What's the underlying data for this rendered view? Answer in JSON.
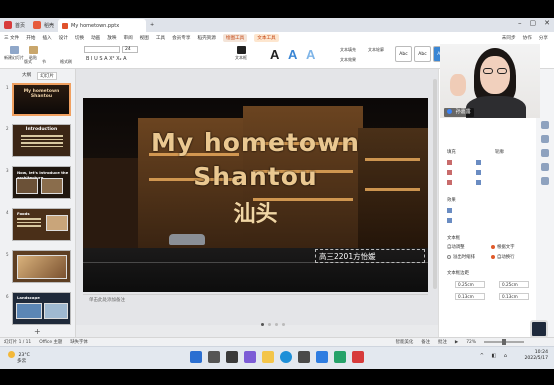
{
  "titlebar": {
    "home_tab": "首页",
    "app_tab": "稻壳",
    "doc_tab": "My hometown.pptx",
    "add_tab": "+"
  },
  "menubar": {
    "file": "三 文件",
    "items": [
      "开始",
      "插入",
      "设计",
      "切换",
      "动画",
      "放映",
      "审阅",
      "视图",
      "工具",
      "会员专享",
      "稻壳资源"
    ],
    "highlight1": "绘图工具",
    "highlight2": "文本工具",
    "right": [
      "未同步",
      "协作",
      "分享"
    ]
  },
  "ribbon": {
    "new_slide": "新建幻灯片",
    "layout": "版式",
    "section": "节",
    "reset": "重置",
    "paste": "粘贴",
    "format_painter": "格式刷",
    "font_name": "",
    "font_size": "24",
    "format_row": "B I U S A X² X₂ A",
    "textbox": "文本框",
    "arrange": "排列",
    "art_A": "A",
    "style_abc1": "Abc",
    "style_abc2": "Abc",
    "style_abc3": "Abc",
    "shape_fill": "形状填充",
    "text_fill": "文本填充",
    "text_outline": "文本轮廓",
    "text_effect": "文本效果"
  },
  "leftpanel": {
    "tab_outline": "大纲",
    "tab_slides": "幻灯片",
    "thumbs": [
      {
        "num": "1",
        "title": "My hometown\nShantou"
      },
      {
        "num": "2",
        "title": "Introduction"
      },
      {
        "num": "3",
        "title": "Now, let's introduce the architecture"
      },
      {
        "num": "4",
        "title": "Foods"
      },
      {
        "num": "5",
        "title": ""
      },
      {
        "num": "6",
        "title": "Landscape"
      }
    ],
    "add": "+"
  },
  "slide": {
    "title1": "My hometown",
    "title2": "Shantou",
    "title3": "汕头",
    "subtitle": "高三2201方怡媛"
  },
  "notes": "单击此处添加备注",
  "rightpanel": {
    "fill": "填充",
    "outline": "轮廓",
    "effect": "效果",
    "textbox_section": "文本框",
    "autofit_label": "自动调整",
    "autofit_opt1": "根据文字",
    "autofit_opt2": "溢出时缩排",
    "autofit_opt3": "自动换行",
    "margins_label": "文本框边距",
    "margin_left": "0.25cm",
    "margin_right": "0.25cm",
    "margin_top": "0.13cm",
    "margin_bottom": "0.13cm"
  },
  "webcam": {
    "name": "孙嘉露"
  },
  "statusbar": {
    "slide_info": "幻灯片 1 / 11",
    "theme": "Office 主题",
    "missing_font": "缺失字体",
    "smart_beauty": "智能美化",
    "notes": "备注",
    "comments": "批注",
    "zoom": "72%"
  },
  "taskbar": {
    "weather_temp": "23°C",
    "weather_desc": "多云",
    "time": "10:24",
    "date": "2022/5/17"
  },
  "colors": {
    "accent": "#e05a2a",
    "slide_title": "#eac891",
    "wps_red": "#d73b3b"
  }
}
